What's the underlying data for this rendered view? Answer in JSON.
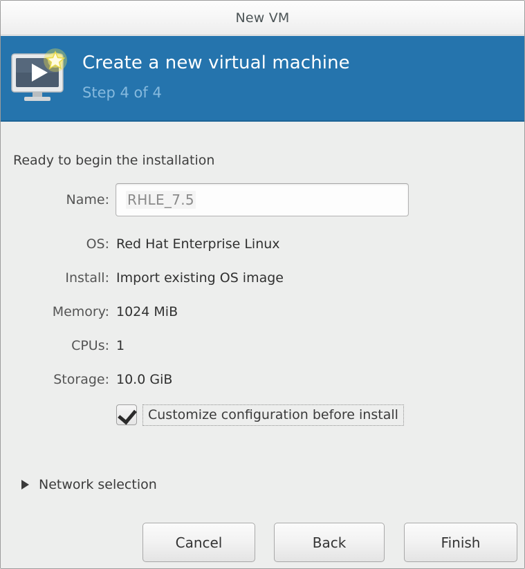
{
  "window": {
    "title": "New VM"
  },
  "banner": {
    "icon": "new-vm-monitor-star-icon",
    "title": "Create a new virtual machine",
    "step": "Step 4 of 4",
    "color": "#2574ad",
    "step_color": "#86bade"
  },
  "body": {
    "ready_text": "Ready to begin the installation",
    "name": {
      "label": "Name:",
      "value": "RHLE_7.5"
    },
    "summary": [
      {
        "label": "OS:",
        "value": "Red Hat Enterprise Linux"
      },
      {
        "label": "Install:",
        "value": "Import existing OS image"
      },
      {
        "label": "Memory:",
        "value": "1024 MiB"
      },
      {
        "label": "CPUs:",
        "value": "1"
      },
      {
        "label": "Storage:",
        "value": "10.0 GiB"
      }
    ],
    "customize": {
      "label": "Customize configuration before install",
      "checked": true
    },
    "network": {
      "label": "Network selection",
      "expanded": false,
      "arrow_icon": "triangle-right-icon"
    }
  },
  "buttons": {
    "cancel": "Cancel",
    "back": "Back",
    "finish": "Finish"
  }
}
